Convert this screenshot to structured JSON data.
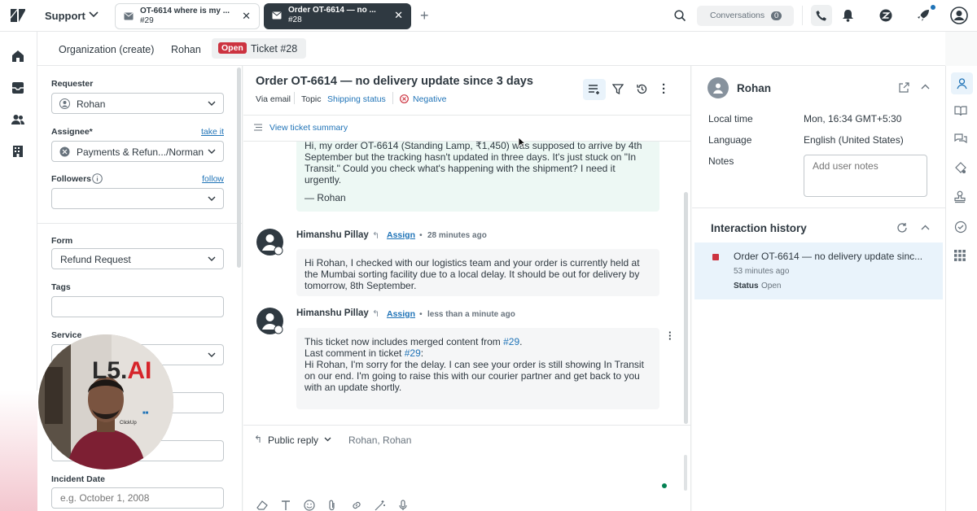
{
  "app": {
    "name": "Support"
  },
  "tabs": [
    {
      "title": "OT-6614 where is my ...",
      "sub": "#29"
    },
    {
      "title": "Order OT-6614 — no ...",
      "sub": "#28"
    }
  ],
  "top_right": {
    "conversations_label": "Conversations",
    "conversations_count": "0"
  },
  "breadcrumb": {
    "org": "Organization (create)",
    "user": "Rohan",
    "status_badge": "Open",
    "ticket": "Ticket #28"
  },
  "properties": {
    "requester_label": "Requester",
    "requester_value": "Rohan",
    "assignee_label": "Assignee*",
    "assignee_link": "take it",
    "assignee_value": "Payments & Refun.../Norman",
    "followers_label": "Followers",
    "followers_link": "follow",
    "form_label": "Form",
    "form_value": "Refund Request",
    "tags_label": "Tags",
    "service_label": "Service",
    "incident_label": "Incident Date",
    "incident_placeholder": "e.g. October 1, 2008"
  },
  "ticket": {
    "title": "Order OT-6614 — no delivery update since 3 days",
    "channel": "Via email",
    "topic_label": "Topic",
    "topic_value": "Shipping status",
    "sentiment": "Negative",
    "summary_link": "View ticket summary"
  },
  "messages": [
    {
      "text1": "Hi, my order OT-6614 (Standing Lamp, ₹1,450) was supposed to arrive by 4th September but the tracking hasn't updated in three days. It's just stuck on \"In Transit.\" Could you check what's happening with the shipment? I need it urgently.",
      "sign": "— Rohan"
    },
    {
      "author": "Himanshu Pillay",
      "assign": "Assign",
      "time": "28 minutes ago",
      "text1": "Hi Rohan, I checked with our logistics team and your order is currently held at the Mumbai sorting facility due to a local delay. It should be out for delivery by tomorrow, 8th September."
    },
    {
      "author": "Himanshu Pillay",
      "assign": "Assign",
      "time": "less than a minute ago",
      "merged_prefix": "This ticket now includes merged content from ",
      "merged_link": "#29",
      "merged_suffix": ".",
      "last_prefix": "Last comment in ticket ",
      "last_link": "#29",
      "last_suffix": ":",
      "text1": "Hi Rohan, I'm sorry for the delay. I can see your order is still showing In Transit on our end. I'm going to raise this with our courier partner and get back to you with an update shortly."
    }
  ],
  "reply": {
    "mode": "Public reply",
    "to": "Rohan, Rohan"
  },
  "user_panel": {
    "name": "Rohan",
    "local_time_label": "Local time",
    "local_time_value": "Mon, 16:34 GMT+5:30",
    "language_label": "Language",
    "language_value": "English (United States)",
    "notes_label": "Notes",
    "notes_placeholder": "Add user notes"
  },
  "history": {
    "title": "Interaction history",
    "item_title": "Order OT-6614 — no delivery update sinc...",
    "item_time": "53 minutes ago",
    "item_status_label": "Status",
    "item_status_value": "Open"
  },
  "webcam": {
    "logo": "L5.AI"
  },
  "colors": {
    "accent": "#1f73b7",
    "danger": "#cc3340",
    "tab_active": "#2f3941",
    "highlight": "#e9f3fb",
    "bubble_customer": "#edf8f4"
  }
}
